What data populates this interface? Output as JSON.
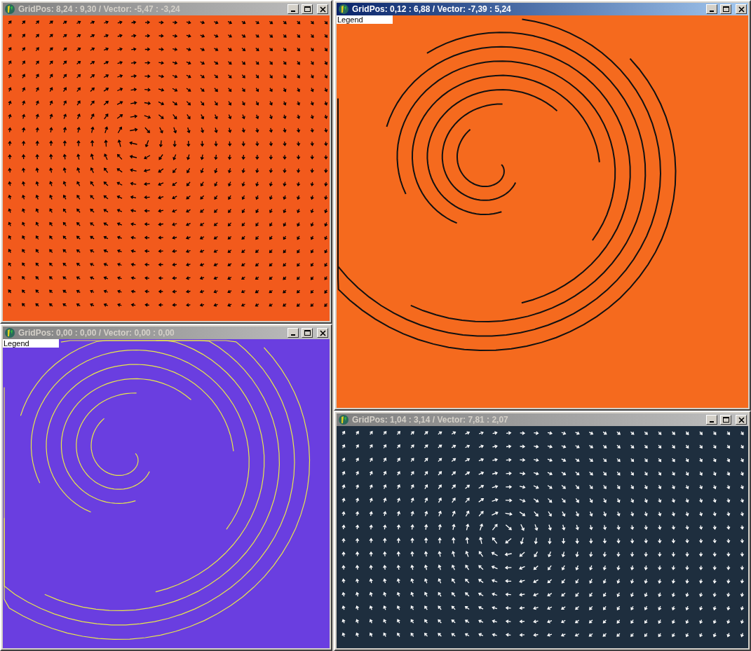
{
  "windows": [
    {
      "title": "GridPos: 8,24 : 9,30 / Vector: -5,47 : -3,24",
      "active": false,
      "kind": "arrows",
      "color": "#f25a1c"
    },
    {
      "title": "GridPos: 0,12 : 6,88 / Vector: -7,39 : 5,24",
      "active": true,
      "kind": "streamlines",
      "color": "#f56a1e",
      "legend": "Legend"
    },
    {
      "title": "GridPos: 0,00 : 0,00 / Vector: 0,00 : 0,00",
      "active": false,
      "kind": "streamlines",
      "color": "#6a3ee0",
      "legend": "Legend"
    },
    {
      "title": "GridPos: 1,04 : 3,14 / Vector: 7,81 : 2,07",
      "active": false,
      "kind": "arrows",
      "color": "#1e2e3e"
    }
  ]
}
